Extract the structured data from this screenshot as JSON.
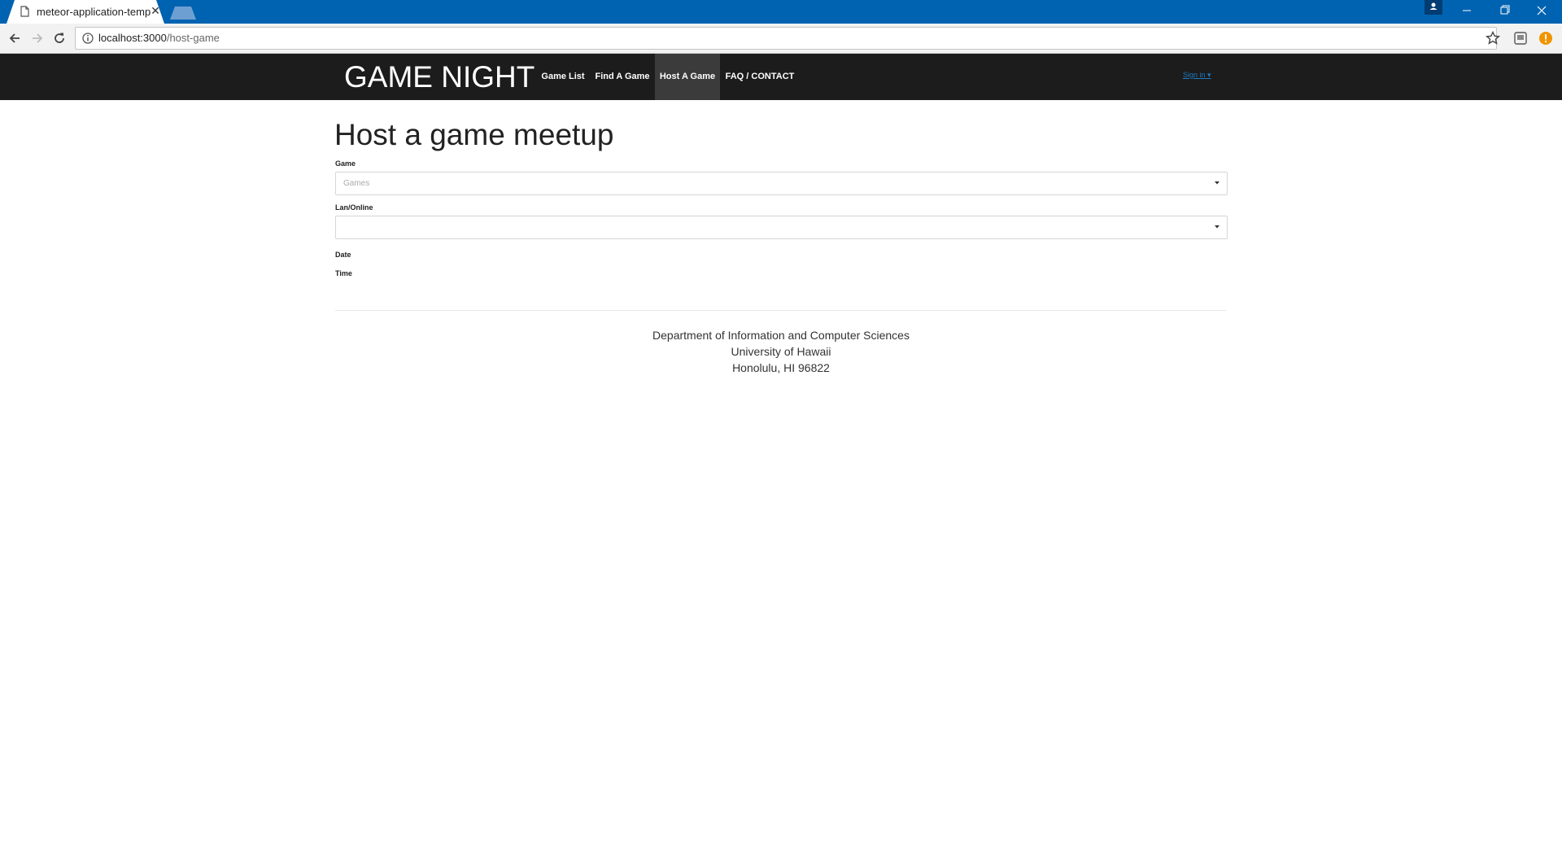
{
  "browser": {
    "tab_title": "meteor-application-template",
    "tab_close": "✕",
    "url_host": "localhost:3000",
    "url_path": "/host-game"
  },
  "navbar": {
    "brand": "GAME NIGHT",
    "items": [
      {
        "label": "Game List"
      },
      {
        "label": "Find A Game"
      },
      {
        "label": "Host A Game",
        "active": true
      },
      {
        "label": "FAQ / CONTACT"
      }
    ],
    "signin": "Sign in ▾"
  },
  "form": {
    "title": "Host a game meetup",
    "game_label": "Game",
    "game_placeholder": "Games",
    "lan_label": "Lan/Online",
    "lan_value": "",
    "date_label": "Date",
    "time_label": "Time"
  },
  "footer": {
    "line1": "Department of Information and Computer Sciences",
    "line2": "University of Hawaii",
    "line3": "Honolulu, HI 96822"
  },
  "colors": {
    "titlebar": "#0063b1",
    "navbar": "#1c1c1c",
    "nav_active": "#3b3b3b",
    "link": "#1c7ac0"
  },
  "icons": [
    "page-icon",
    "back-icon",
    "forward-icon",
    "reload-icon",
    "info-icon",
    "star-icon",
    "extension-icon",
    "alert-icon",
    "chevron-down-icon",
    "profile-icon",
    "minimize-icon",
    "maximize-icon",
    "close-icon"
  ]
}
